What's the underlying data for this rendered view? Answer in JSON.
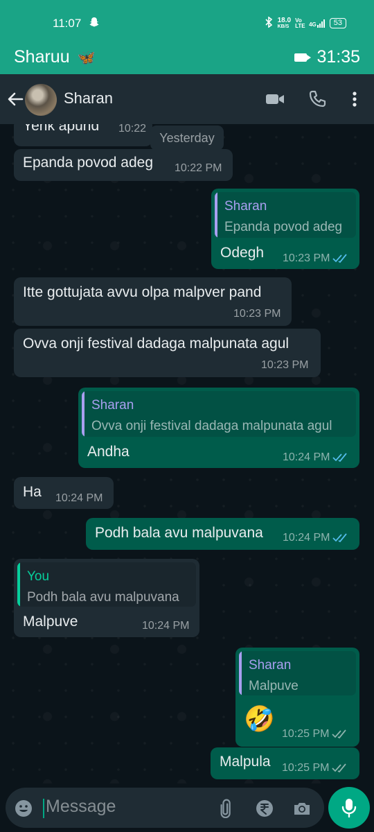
{
  "status_bar": {
    "time": "11:07",
    "snapchat_icon": "ghost-icon",
    "net_speed": "18.0",
    "net_unit": "KB/S",
    "volte": "Vo LTE",
    "signal": "4G",
    "battery": "53"
  },
  "call_bar": {
    "caller_name": "Sharuu",
    "caller_emoji": "🦋",
    "duration": "31:35"
  },
  "header": {
    "contact_name": "Sharan"
  },
  "date_chip": "Yesterday",
  "messages": [
    {
      "dir": "in",
      "text": "Yenk apund",
      "time": "10:22"
    },
    {
      "dir": "in",
      "text": "Epanda povod adeg",
      "time": "10:22 PM"
    },
    {
      "dir": "out",
      "quote_name": "Sharan",
      "quote_text": "Epanda povod adeg",
      "text": "Odegh",
      "time": "10:23 PM"
    },
    {
      "dir": "in",
      "text": "Itte gottujata avvu olpa malpver pand",
      "time": "10:23 PM"
    },
    {
      "dir": "in",
      "text": "Ovva onji festival dadaga malpunata agul",
      "time": "10:23 PM"
    },
    {
      "dir": "out",
      "quote_name": "Sharan",
      "quote_text": "Ovva onji festival dadaga malpunata agul",
      "text": "Andha",
      "time": "10:24 PM"
    },
    {
      "dir": "in",
      "text": "Ha",
      "time": "10:24 PM"
    },
    {
      "dir": "out",
      "text": "Podh bala avu malpuvana",
      "time": "10:24 PM"
    },
    {
      "dir": "in",
      "quote_name": "You",
      "quote_text": "Podh bala avu malpuvana",
      "text": "Malpuve",
      "time": "10:24 PM"
    },
    {
      "dir": "out",
      "quote_name": "Sharan",
      "quote_text": "Malpuve",
      "text": "🤣",
      "time": "10:25 PM"
    },
    {
      "dir": "out",
      "text": "Malpula",
      "time": "10:25 PM"
    }
  ],
  "composer": {
    "placeholder": "Message"
  },
  "colors": {
    "accent": "#00a884",
    "call_bar": "#1aa486",
    "incoming_bubble": "#1f2c34",
    "outgoing_bubble": "#005c4b",
    "read_tick": "#53bdeb",
    "quote_sharan": "#a99ff0",
    "quote_you": "#06cf9c"
  }
}
